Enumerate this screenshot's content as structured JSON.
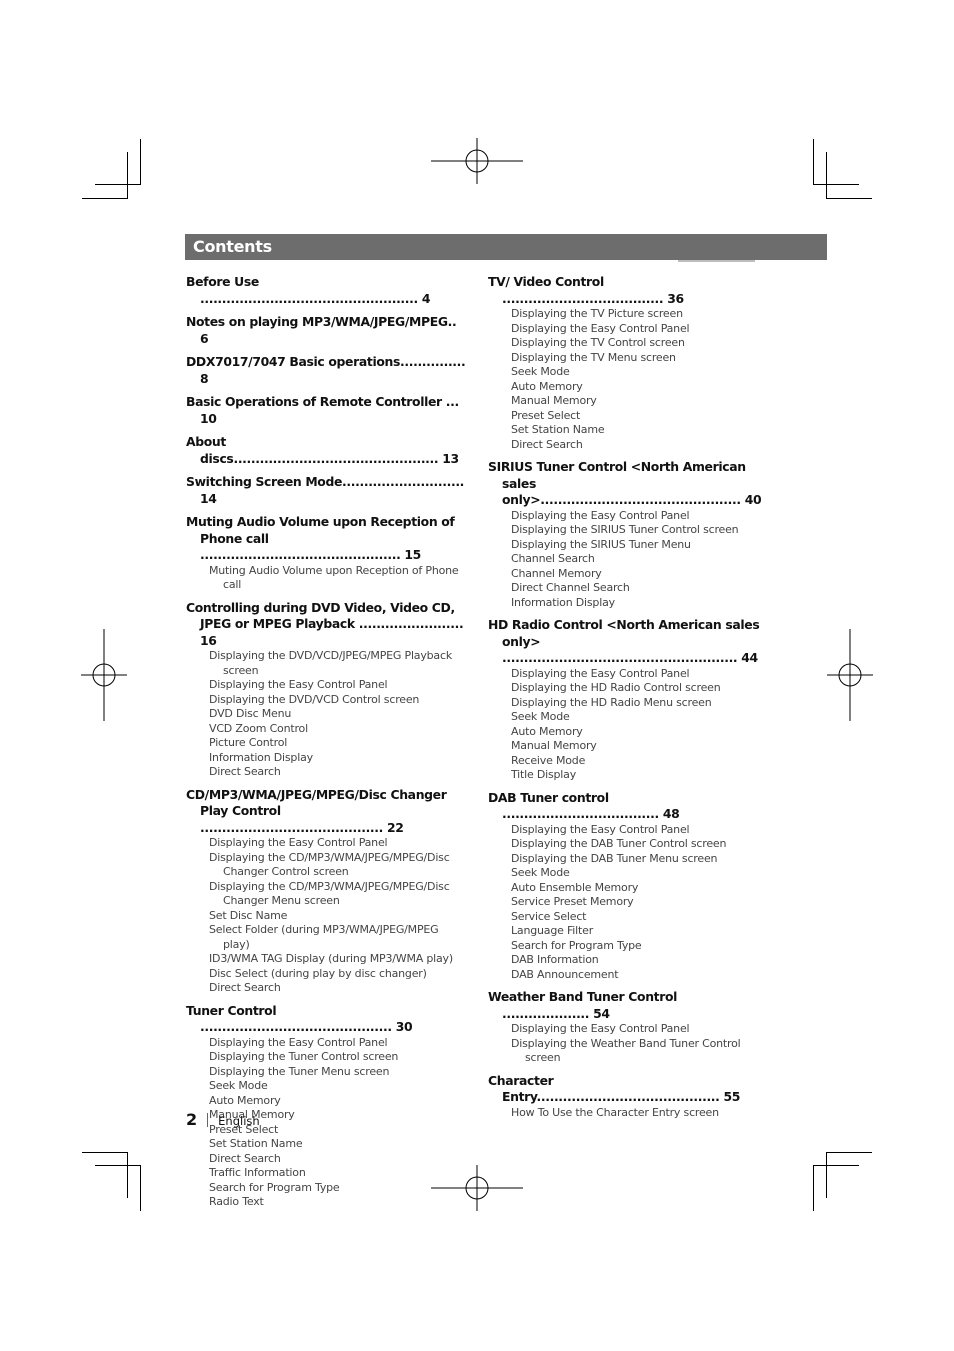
{
  "header": {
    "title": "Contents"
  },
  "left_column": [
    {
      "title": "Before Use",
      "dots": " ..................................................",
      "page": "4",
      "items": []
    },
    {
      "title": "Notes on playing MP3/WMA/JPEG/MPEG",
      "dots": "..",
      "page": "6",
      "items": []
    },
    {
      "title": "DDX7017/7047 Basic operations",
      "dots": "...............",
      "page": "8",
      "items": []
    },
    {
      "title": "Basic Operations of Remote Controller",
      "dots": " ...",
      "page": "10",
      "items": []
    },
    {
      "title": "About discs",
      "dots": "...............................................",
      "page": "13",
      "items": []
    },
    {
      "title": "Switching Screen Mode",
      "dots": "............................",
      "page": "14",
      "items": []
    },
    {
      "title": "Muting Audio Volume upon Reception of Phone call",
      "dots": " ..............................................",
      "page": "15",
      "items": [
        "Muting Audio Volume upon Reception of Phone call"
      ]
    },
    {
      "title": "Controlling during DVD Video, Video CD, JPEG or MPEG Playback",
      "dots": " ........................",
      "page": "16",
      "items": [
        "Displaying the DVD/VCD/JPEG/MPEG Playback screen",
        "Displaying the Easy Control Panel",
        "Displaying the DVD/VCD Control screen",
        "DVD Disc Menu",
        "VCD Zoom Control",
        "Picture Control",
        "Information Display",
        "Direct Search"
      ]
    },
    {
      "title": "CD/MP3/WMA/JPEG/MPEG/Disc Changer Play Control",
      "dots": "  ..........................................",
      "page": "22",
      "items": [
        "Displaying the Easy Control Panel",
        "Displaying the CD/MP3/WMA/JPEG/MPEG/Disc Changer Control screen",
        "Displaying the CD/MP3/WMA/JPEG/MPEG/Disc Changer Menu screen",
        "Set Disc Name",
        "Select Folder (during MP3/WMA/JPEG/MPEG play)",
        "ID3/WMA TAG Display (during MP3/WMA play)",
        "Disc Select (during play by disc changer)",
        "Direct Search"
      ]
    },
    {
      "title": "Tuner Control",
      "dots": " ............................................",
      "page": "30",
      "items": [
        "Displaying the Easy Control Panel",
        "Displaying the Tuner Control screen",
        "Displaying the Tuner Menu screen",
        "Seek Mode",
        "Auto Memory",
        "Manual Memory",
        "Preset Select",
        "Set Station Name",
        "Direct Search",
        "Traffic Information",
        "Search for Program Type",
        "Radio Text"
      ]
    }
  ],
  "right_column": [
    {
      "title": "TV/ Video Control",
      "dots": " .....................................",
      "page": "36",
      "items": [
        "Displaying the TV Picture screen",
        "Displaying the Easy Control Panel",
        "Displaying the TV Control screen",
        "Displaying the TV Menu screen",
        "Seek Mode",
        "Auto Memory",
        "Manual Memory",
        "Preset Select",
        "Set Station Name",
        "Direct Search"
      ]
    },
    {
      "title": "SIRIUS Tuner Control <North American sales only>",
      "dots": "..............................................",
      "page": "40",
      "items": [
        "Displaying the Easy Control Panel",
        "Displaying the SIRIUS Tuner Control screen",
        "Displaying the SIRIUS Tuner Menu",
        "Channel Search",
        "Channel Memory",
        "Direct Channel Search",
        "Information Display"
      ]
    },
    {
      "title": "HD Radio Control <North American sales only>",
      "dots": " ......................................................",
      "page": "44",
      "items": [
        "Displaying the Easy Control Panel",
        "Displaying the HD Radio Control screen",
        "Displaying the HD Radio Menu screen",
        "Seek Mode",
        "Auto Memory",
        "Manual Memory",
        "Receive Mode",
        "Title Display"
      ]
    },
    {
      "title": "DAB Tuner control",
      "dots": " ....................................",
      "page": "48",
      "items": [
        "Displaying the Easy Control Panel",
        "Displaying the DAB Tuner Control screen",
        "Displaying the DAB Tuner Menu screen",
        "Seek Mode",
        "Auto Ensemble Memory",
        "Service Preset Memory",
        "Service Select",
        "Language Filter",
        "Search for Program Type",
        "DAB Information",
        "DAB Announcement"
      ]
    },
    {
      "title": "Weather Band Tuner Control",
      "dots": " ....................",
      "page": "54",
      "items": [
        "Displaying the Easy Control Panel",
        "Displaying the Weather Band Tuner Control screen"
      ]
    },
    {
      "title": "Character Entry",
      "dots": "..........................................",
      "page": "55",
      "items": [
        "How To Use the Character Entry screen"
      ]
    }
  ],
  "footer": {
    "page_number": "2",
    "language": "English"
  }
}
